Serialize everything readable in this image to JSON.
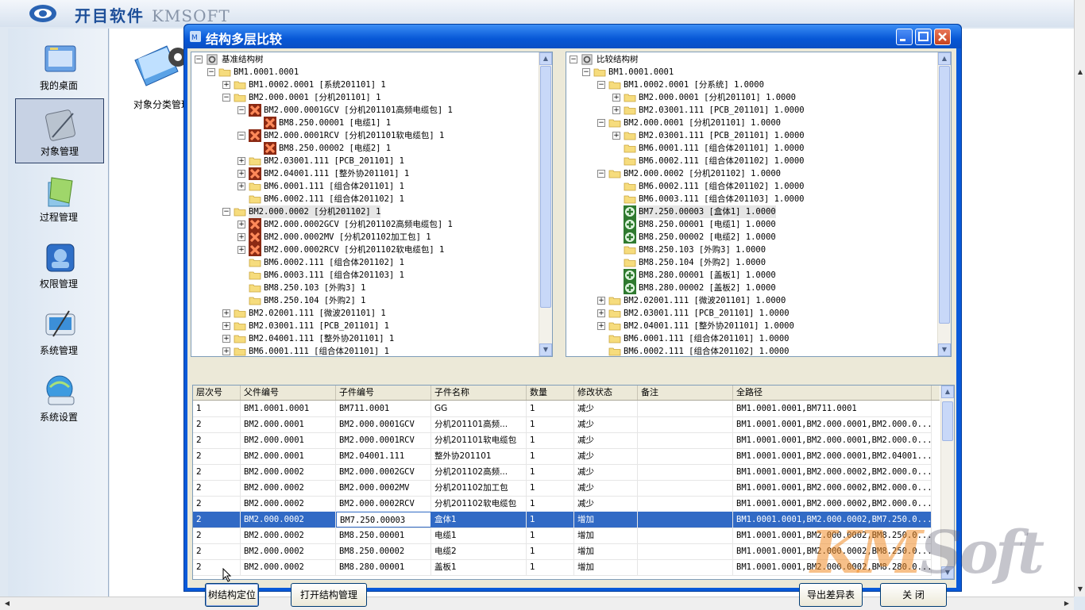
{
  "app": {
    "title_cn": "开目软件",
    "title_en": "KMSOFT"
  },
  "nav": {
    "items": [
      {
        "label": "我的桌面",
        "icon": "desktop-icon"
      },
      {
        "label": "对象管理",
        "icon": "object-management-icon",
        "active": true
      },
      {
        "label": "过程管理",
        "icon": "process-management-icon"
      },
      {
        "label": "权限管理",
        "icon": "permission-management-icon"
      },
      {
        "label": "系统管理",
        "icon": "system-management-icon"
      },
      {
        "label": "系统设置",
        "icon": "system-settings-icon"
      }
    ]
  },
  "desktop": {
    "icon_label": "对象分类管理"
  },
  "dialog": {
    "title": "结构多层比较",
    "base_tree": {
      "root_label": "基准结构树",
      "nodes": [
        {
          "d": 0,
          "e": "-",
          "i": "folder",
          "t": "BM1.0001.0001"
        },
        {
          "d": 1,
          "e": "+",
          "i": "folder",
          "t": "BM1.0002.0001 [系统201101] 1"
        },
        {
          "d": 1,
          "e": "-",
          "i": "folder",
          "t": "BM2.000.0001 [分机201101] 1"
        },
        {
          "d": 2,
          "e": "-",
          "i": "x",
          "t": "BM2.000.0001GCV [分机201101高频电缆包] 1"
        },
        {
          "d": 3,
          "e": "",
          "i": "x",
          "t": "BM8.250.00001 [电缆1] 1"
        },
        {
          "d": 2,
          "e": "-",
          "i": "x",
          "t": "BM2.000.0001RCV [分机201101软电缆包] 1"
        },
        {
          "d": 3,
          "e": "",
          "i": "x",
          "t": "BM8.250.00002 [电缆2] 1"
        },
        {
          "d": 2,
          "e": "+",
          "i": "folder",
          "t": "BM2.03001.111 [PCB_201101] 1"
        },
        {
          "d": 2,
          "e": "+",
          "i": "x",
          "t": "BM2.04001.111 [整外协201101] 1"
        },
        {
          "d": 2,
          "e": "+",
          "i": "folder",
          "t": "BM6.0001.111 [组合体201101] 1"
        },
        {
          "d": 2,
          "e": "",
          "i": "folder",
          "t": "BM6.0002.111 [组合体201102] 1"
        },
        {
          "d": 1,
          "e": "-",
          "i": "folder",
          "t": "BM2.000.0002 [分机201102] 1",
          "sel": true
        },
        {
          "d": 2,
          "e": "+",
          "i": "x",
          "t": "BM2.000.0002GCV [分机201102高频电缆包] 1"
        },
        {
          "d": 2,
          "e": "+",
          "i": "x",
          "t": "BM2.000.0002MV [分机201102加工包] 1"
        },
        {
          "d": 2,
          "e": "+",
          "i": "x",
          "t": "BM2.000.0002RCV [分机201102软电缆包] 1"
        },
        {
          "d": 2,
          "e": "",
          "i": "folder",
          "t": "BM6.0002.111 [组合体201102] 1"
        },
        {
          "d": 2,
          "e": "",
          "i": "folder",
          "t": "BM6.0003.111 [组合体201103] 1"
        },
        {
          "d": 2,
          "e": "",
          "i": "folder",
          "t": "BM8.250.103 [外购3] 1"
        },
        {
          "d": 2,
          "e": "",
          "i": "folder",
          "t": "BM8.250.104 [外购2] 1"
        },
        {
          "d": 1,
          "e": "+",
          "i": "folder",
          "t": "BM2.02001.111 [微波201101] 1"
        },
        {
          "d": 1,
          "e": "+",
          "i": "folder",
          "t": "BM2.03001.111 [PCB_201101] 1"
        },
        {
          "d": 1,
          "e": "+",
          "i": "folder",
          "t": "BM2.04001.111 [整外协201101] 1"
        },
        {
          "d": 1,
          "e": "+",
          "i": "folder",
          "t": "BM6.0001.111 [组合体201101] 1"
        }
      ]
    },
    "compare_tree": {
      "root_label": "比较结构树",
      "nodes": [
        {
          "d": 0,
          "e": "-",
          "i": "folder",
          "t": "BM1.0001.0001"
        },
        {
          "d": 1,
          "e": "-",
          "i": "folder",
          "t": "BM1.0002.0001 [分系统] 1.0000"
        },
        {
          "d": 2,
          "e": "+",
          "i": "folder",
          "t": "BM2.000.0001 [分机201101] 1.0000"
        },
        {
          "d": 2,
          "e": "+",
          "i": "folder",
          "t": "BM2.03001.111 [PCB_201101] 1.0000"
        },
        {
          "d": 1,
          "e": "-",
          "i": "folder",
          "t": "BM2.000.0001 [分机201101] 1.0000"
        },
        {
          "d": 2,
          "e": "+",
          "i": "folder",
          "t": "BM2.03001.111 [PCB_201101] 1.0000"
        },
        {
          "d": 2,
          "e": "",
          "i": "folder",
          "t": "BM6.0001.111 [组合体201101] 1.0000"
        },
        {
          "d": 2,
          "e": "",
          "i": "folder",
          "t": "BM6.0002.111 [组合体201102] 1.0000"
        },
        {
          "d": 1,
          "e": "-",
          "i": "folder",
          "t": "BM2.000.0002 [分机201102] 1.0000"
        },
        {
          "d": 2,
          "e": "",
          "i": "folder",
          "t": "BM6.0002.111 [组合体201102] 1.0000"
        },
        {
          "d": 2,
          "e": "",
          "i": "folder",
          "t": "BM6.0003.111 [组合体201103] 1.0000"
        },
        {
          "d": 2,
          "e": "",
          "i": "plus",
          "t": "BM7.250.00003 [盒体1] 1.0000",
          "sel": true
        },
        {
          "d": 2,
          "e": "",
          "i": "plus",
          "t": "BM8.250.00001 [电缆1] 1.0000"
        },
        {
          "d": 2,
          "e": "",
          "i": "plus",
          "t": "BM8.250.00002 [电缆2] 1.0000"
        },
        {
          "d": 2,
          "e": "",
          "i": "folder",
          "t": "BM8.250.103 [外购3] 1.0000"
        },
        {
          "d": 2,
          "e": "",
          "i": "folder",
          "t": "BM8.250.104 [外购2] 1.0000"
        },
        {
          "d": 2,
          "e": "",
          "i": "plus",
          "t": "BM8.280.00001 [盖板1] 1.0000"
        },
        {
          "d": 2,
          "e": "",
          "i": "plus",
          "t": "BM8.280.00002 [盖板2] 1.0000"
        },
        {
          "d": 1,
          "e": "+",
          "i": "folder",
          "t": "BM2.02001.111 [微波201101] 1.0000"
        },
        {
          "d": 1,
          "e": "+",
          "i": "folder",
          "t": "BM2.03001.111 [PCB_201101] 1.0000"
        },
        {
          "d": 1,
          "e": "+",
          "i": "folder",
          "t": "BM2.04001.111 [整外协201101] 1.0000"
        },
        {
          "d": 1,
          "e": "",
          "i": "folder",
          "t": "BM6.0001.111 [组合体201101] 1.0000"
        },
        {
          "d": 1,
          "e": "",
          "i": "folder",
          "t": "BM6.0002.111 [组合体201102] 1.0000"
        }
      ]
    },
    "grid": {
      "columns": [
        "层次号",
        "父件编号",
        "子件编号",
        "子件名称",
        "数量",
        "修改状态",
        "备注",
        "全路径"
      ],
      "rows": [
        [
          "1",
          "BM1.0001.0001",
          "BM711.0001",
          "GG",
          "1",
          "减少",
          "",
          "BM1.0001.0001,BM711.0001"
        ],
        [
          "2",
          "BM2.000.0001",
          "BM2.000.0001GCV",
          "分机201101高频...",
          "1",
          "减少",
          "",
          "BM1.0001.0001,BM2.000.0001,BM2.000.0..."
        ],
        [
          "2",
          "BM2.000.0001",
          "BM2.000.0001RCV",
          "分机201101软电缆包",
          "1",
          "减少",
          "",
          "BM1.0001.0001,BM2.000.0001,BM2.000.0..."
        ],
        [
          "2",
          "BM2.000.0001",
          "BM2.04001.111",
          "整外协201101",
          "1",
          "减少",
          "",
          "BM1.0001.0001,BM2.000.0001,BM2.04001..."
        ],
        [
          "2",
          "BM2.000.0002",
          "BM2.000.0002GCV",
          "分机201102高频...",
          "1",
          "减少",
          "",
          "BM1.0001.0001,BM2.000.0002,BM2.000.0..."
        ],
        [
          "2",
          "BM2.000.0002",
          "BM2.000.0002MV",
          "分机201102加工包",
          "1",
          "减少",
          "",
          "BM1.0001.0001,BM2.000.0002,BM2.000.0..."
        ],
        [
          "2",
          "BM2.000.0002",
          "BM2.000.0002RCV",
          "分机201102软电缆包",
          "1",
          "减少",
          "",
          "BM1.0001.0001,BM2.000.0002,BM2.000.0..."
        ],
        [
          "2",
          "BM2.000.0002",
          "BM7.250.00003",
          "盒体1",
          "1",
          "增加",
          "",
          "BM1.0001.0001,BM2.000.0002,BM7.250.0..."
        ],
        [
          "2",
          "BM2.000.0002",
          "BM8.250.00001",
          "电缆1",
          "1",
          "增加",
          "",
          "BM1.0001.0001,BM2.000.0002,BM8.250.0..."
        ],
        [
          "2",
          "BM2.000.0002",
          "BM8.250.00002",
          "电缆2",
          "1",
          "增加",
          "",
          "BM1.0001.0001,BM2.000.0002,BM8.250.0..."
        ],
        [
          "2",
          "BM2.000.0002",
          "BM8.280.00001",
          "盖板1",
          "1",
          "增加",
          "",
          "BM1.0001.0001,BM2.000.0002,BM8.280.0..."
        ]
      ],
      "selected_row": 7
    },
    "buttons": {
      "locate": "树结构定位",
      "open_struct": "打开结构管理",
      "export": "导出差异表",
      "close": "关  闭"
    }
  },
  "watermark": {
    "left": "KM",
    "right": "Soft"
  }
}
